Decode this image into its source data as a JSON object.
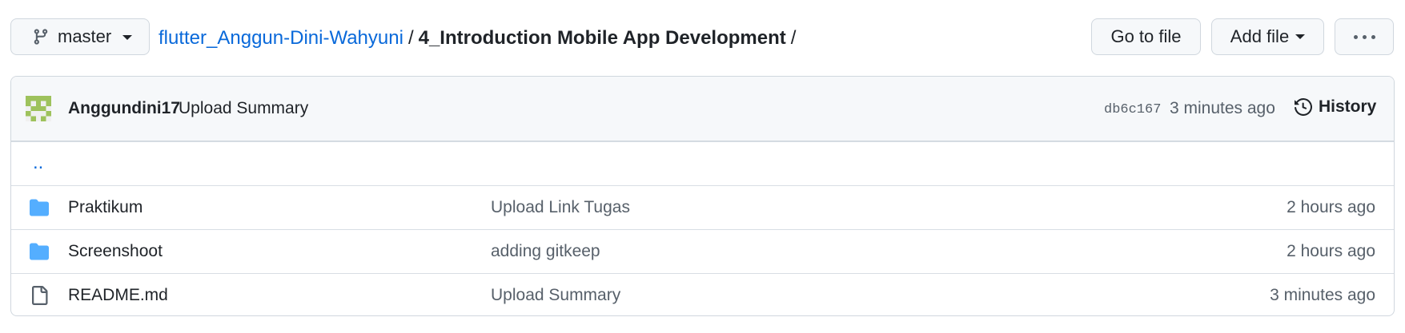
{
  "branch": {
    "name": "master"
  },
  "breadcrumb": {
    "repo": "flutter_Anggun-Dini-Wahyuni",
    "separator": "/",
    "folder": "4_Introduction Mobile App Development",
    "trailing": "/"
  },
  "actions": {
    "go_to_file": "Go to file",
    "add_file": "Add file"
  },
  "latest_commit": {
    "author": "Anggundini17",
    "message": "Upload Summary",
    "sha": "db6c167",
    "time": "3 minutes ago",
    "history_label": "History"
  },
  "parent_link": "..",
  "files": [
    {
      "name": "Praktikum",
      "type": "folder",
      "commit": "Upload Link Tugas",
      "age": "2 hours ago"
    },
    {
      "name": "Screenshoot",
      "type": "folder",
      "commit": "adding gitkeep",
      "age": "2 hours ago"
    },
    {
      "name": "README.md",
      "type": "file",
      "commit": "Upload Summary",
      "age": "3 minutes ago"
    }
  ],
  "colors": {
    "link": "#0969da",
    "folder": "#54aeff",
    "avatar": "#9ec25c"
  }
}
